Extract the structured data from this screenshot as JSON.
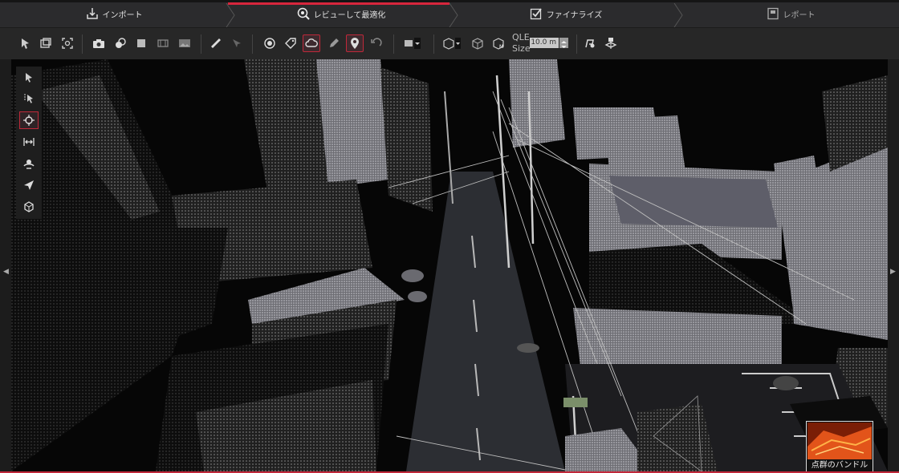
{
  "workflow": {
    "steps": [
      {
        "label": "インポート",
        "icon": "import-icon"
      },
      {
        "label": "レビューして最適化",
        "icon": "review-optimize-icon",
        "active": true
      },
      {
        "label": "ファイナライズ",
        "icon": "finalize-checkbox-icon"
      },
      {
        "label": "レポート",
        "icon": "report-icon"
      }
    ],
    "active_color": "#d7263d"
  },
  "toolbar": {
    "groups": [
      [
        "select-points-icon",
        "window-icon",
        "zoom-extents-icon"
      ],
      [
        "camera-icon",
        "color-mode-icon",
        "square-view-icon",
        "filmstrip-icon",
        "image-icon"
      ],
      [
        "ruler-icon",
        "transform-icon"
      ],
      [
        "circle-target-icon",
        "tag-icon",
        "cloud-icon",
        "pencil-icon",
        "pin-icon",
        "undo-icon"
      ],
      [
        "display-dropdown-icon"
      ],
      [
        "cube-dropdown-icon",
        "cube-view-icon",
        "cube-measure-icon"
      ],
      [
        "person-pin-icon",
        "scan-station-icon"
      ]
    ],
    "active_tools": [
      "cloud-icon",
      "pin-icon"
    ],
    "qle_label": "QLE",
    "size_label": "Size",
    "size_value": "10.0 m"
  },
  "side_tools": {
    "items": [
      "cursor-icon",
      "select-cursor-icon",
      "orbit-crosshair-icon",
      "fit-horizontal-icon",
      "walk-person-icon",
      "navigate-arrow-icon",
      "box-view-icon"
    ],
    "active": "orbit-crosshair-icon"
  },
  "thumbnail": {
    "label": "点群のバンドル"
  },
  "colors": {
    "accent": "#c0283a",
    "toolbar_bg": "#272727",
    "workflow_bg": "#2b2b2d"
  }
}
